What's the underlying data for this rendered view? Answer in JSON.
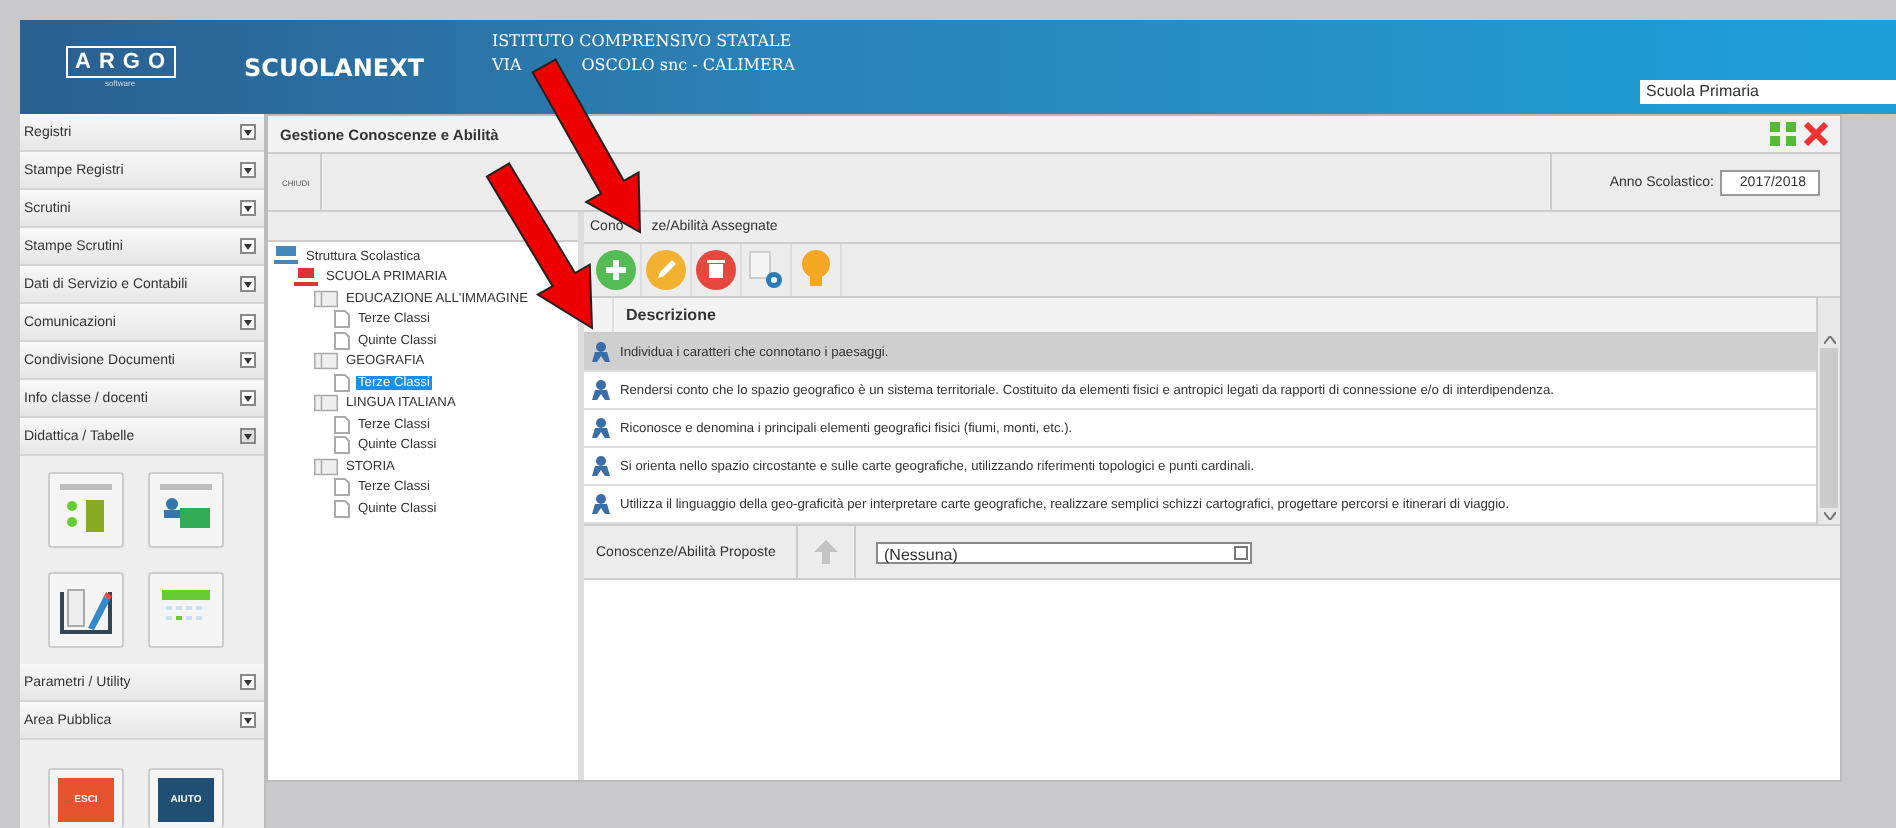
{
  "header": {
    "logo": "ARGO",
    "logo_sub": "software",
    "product": "SCUOLANEXT",
    "school_line1": "ISTITUTO COMPRENSIVO STATALE",
    "school_line2_start": "VIA",
    "school_line2_end": "OSCOLO snc - CALIMERA",
    "school_select": "Scuola Primaria"
  },
  "sidebar": {
    "items": [
      {
        "label": "Registri",
        "expanded": false
      },
      {
        "label": "Stampe Registri",
        "expanded": false
      },
      {
        "label": "Scrutini",
        "expanded": false
      },
      {
        "label": "Stampe Scrutini",
        "expanded": false
      },
      {
        "label": "Dati di Servizio e Contabili",
        "expanded": false
      },
      {
        "label": "Comunicazioni",
        "expanded": false
      },
      {
        "label": "Condivisione Documenti",
        "expanded": false
      },
      {
        "label": "Info classe / docenti",
        "expanded": false
      },
      {
        "label": "Didattica / Tabelle",
        "expanded": true
      },
      {
        "label": "Parametri / Utility",
        "expanded": false
      },
      {
        "label": "Area Pubblica",
        "expanded": false
      }
    ],
    "bottom_buttons": [
      {
        "label": "ESCI",
        "kind": "exit"
      },
      {
        "label": "AIUTO",
        "kind": "help"
      }
    ]
  },
  "panel": {
    "title": "Gestione Conoscenze e Abilità",
    "close_button": "CHIUDI",
    "year_label": "Anno Scolastico:",
    "year_value": "2017/2018",
    "tree": [
      {
        "label": "Struttura Scolastica",
        "kind": "root",
        "selected": false,
        "children": [
          {
            "label": "SCUOLA PRIMARIA",
            "kind": "school",
            "selected": false,
            "children": [
              {
                "label": "EDUCAZIONE ALL'IMMAGINE",
                "kind": "folder",
                "selected": false,
                "children": [
                  {
                    "label": "Terze Classi",
                    "kind": "leaf",
                    "selected": false
                  },
                  {
                    "label": "Quinte Classi",
                    "kind": "leaf",
                    "selected": false
                  }
                ]
              },
              {
                "label": "GEOGRAFIA",
                "kind": "folder",
                "selected": false,
                "children": [
                  {
                    "label": "Terze Classi",
                    "kind": "leaf",
                    "selected": true
                  }
                ]
              },
              {
                "label": "LINGUA ITALIANA",
                "kind": "folder",
                "selected": false,
                "children": [
                  {
                    "label": "Terze Classi",
                    "kind": "leaf",
                    "selected": false
                  },
                  {
                    "label": "Quinte Classi",
                    "kind": "leaf",
                    "selected": false
                  }
                ]
              },
              {
                "label": "STORIA",
                "kind": "folder",
                "selected": false,
                "children": [
                  {
                    "label": "Terze Classi",
                    "kind": "leaf",
                    "selected": false
                  },
                  {
                    "label": "Quinte Classi",
                    "kind": "leaf",
                    "selected": false
                  }
                ]
              }
            ]
          }
        ]
      }
    ],
    "assigned_title_start": "Cono",
    "assigned_title_end": "ze/Abilità Assegnate",
    "toolbar": [
      {
        "kind": "add"
      },
      {
        "kind": "edit"
      },
      {
        "kind": "delete"
      },
      {
        "kind": "settings"
      },
      {
        "kind": "hint"
      }
    ],
    "table": {
      "columns": [
        "Descrizione"
      ],
      "rows": [
        {
          "text": "Individua i caratteri che connotano i paesaggi.",
          "selected": true
        },
        {
          "text": "Rendersi conto che lo spazio geografico è un sistema territoriale. Costituito da elementi fisici e antropici legati da rapporti di connessione e/o di interdipendenza.",
          "selected": false
        },
        {
          "text": "Riconosce e denomina i principali elementi geografici fisici (fiumi, monti, etc.).",
          "selected": false
        },
        {
          "text": "Si orienta nello spazio circostante e sulle carte geografiche, utilizzando riferimenti topologici e punti cardinali.",
          "selected": false
        },
        {
          "text": "Utilizza il linguaggio della geo-graficità per interpretare carte geografiche, realizzare semplici schizzi cartografici, progettare percorsi e itinerari di viaggio.",
          "selected": false
        }
      ]
    },
    "proposed_label": "Conoscenze/Abilità Proposte",
    "proposed_value": "(Nessuna)"
  }
}
